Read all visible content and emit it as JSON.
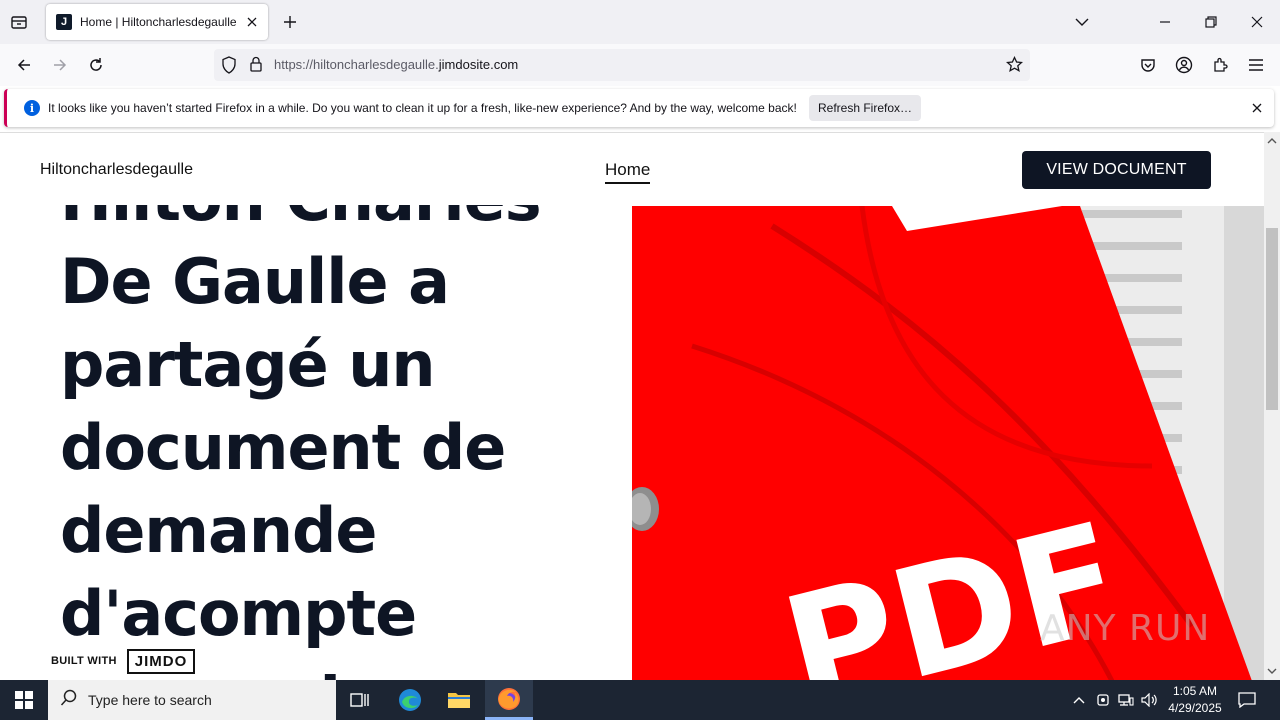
{
  "browser": {
    "tab": {
      "title": "Home | Hiltoncharlesdegaulle",
      "favicon_letter": "J"
    },
    "url": {
      "prefix": "https://hiltoncharlesdegaulle.",
      "domain": "jimdosite.com"
    },
    "notification": {
      "text": "It looks like you haven’t started Firefox in a while. Do you want to clean it up for a fresh, like-new experience? And by the way, welcome back!",
      "button_label": "Refresh Firefox…"
    }
  },
  "site": {
    "brand": "Hiltoncharlesdegaulle",
    "nav_home": "Home",
    "cta_label": "VIEW DOCUMENT",
    "hero_lines": [
      "Hilton Charles",
      "De Gaulle a",
      "partagé un",
      "document de",
      "demande",
      "d'acompte",
      "avec votre soc"
    ],
    "image_text": "PDF",
    "badge": {
      "built_with": "BUILT WITH",
      "logo": "JIMDO"
    }
  },
  "watermark": "ANY RUN",
  "taskbar": {
    "search_placeholder": "Type here to search",
    "time": "1:05 AM",
    "date": "4/29/2025"
  },
  "colors": {
    "cta_bg": "#0e1524",
    "pdf_red": "#ff0000",
    "taskbar_bg": "#1c2533"
  }
}
